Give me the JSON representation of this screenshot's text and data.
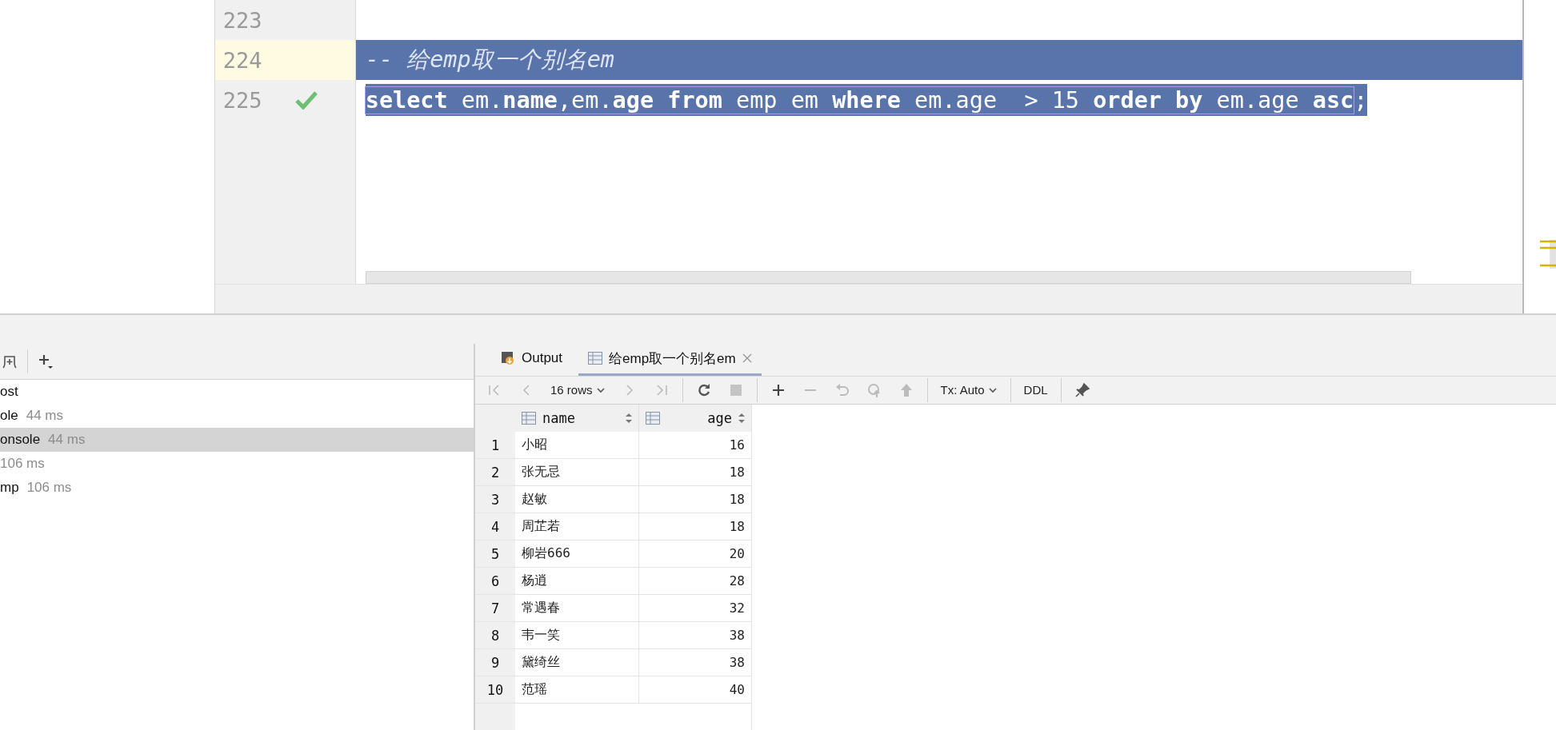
{
  "editor": {
    "lines": [
      {
        "number": "223",
        "current": false,
        "check_mark": false,
        "selected": false
      },
      {
        "number": "224",
        "current": true,
        "check_mark": false,
        "selected": true,
        "tokens": [
          {
            "text": "-- 给emp取一个别名em",
            "kind": "comment"
          }
        ]
      },
      {
        "number": "225",
        "current": false,
        "check_mark": true,
        "selected": true,
        "tokens": [
          {
            "text": "select",
            "kind": "keyword"
          },
          {
            "text": " em.",
            "kind": "plain"
          },
          {
            "text": "name",
            "kind": "keyword"
          },
          {
            "text": ",em.",
            "kind": "plain"
          },
          {
            "text": "age",
            "kind": "keyword"
          },
          {
            "text": " from",
            "kind": "keyword"
          },
          {
            "text": " emp em ",
            "kind": "plain"
          },
          {
            "text": "where",
            "kind": "keyword"
          },
          {
            "text": " em.age  > 15 ",
            "kind": "plain"
          },
          {
            "text": "order by",
            "kind": "keyword"
          },
          {
            "text": " em.age ",
            "kind": "plain"
          },
          {
            "text": "asc",
            "kind": "keyword"
          }
        ],
        "after": ";"
      }
    ]
  },
  "services": [
    {
      "name": "ost",
      "selected": false
    },
    {
      "name": "ole",
      "time": "44 ms",
      "selected": false
    },
    {
      "name": "onsole",
      "time": "44 ms",
      "selected": true
    },
    {
      "time": "106 ms",
      "selected": false
    },
    {
      "name": "mp",
      "time": "106 ms",
      "selected": false
    }
  ],
  "result_tabs": [
    {
      "label": "Output",
      "kind": "output",
      "selected": false
    },
    {
      "label": "给emp取一个别名em",
      "kind": "table",
      "selected": true
    }
  ],
  "result_toolbar": {
    "rows": "16 rows",
    "tx": "Tx: Auto",
    "ddl": "DDL"
  },
  "table": {
    "columns": [
      "name",
      "age"
    ],
    "rows": [
      {
        "index": "1",
        "name": "小昭",
        "age": "16"
      },
      {
        "index": "2",
        "name": "张无忌",
        "age": "18"
      },
      {
        "index": "3",
        "name": "赵敏",
        "age": "18"
      },
      {
        "index": "4",
        "name": "周芷若",
        "age": "18"
      },
      {
        "index": "5",
        "name": "柳岩666",
        "age": "20"
      },
      {
        "index": "6",
        "name": "杨逍",
        "age": "28"
      },
      {
        "index": "7",
        "name": "常遇春",
        "age": "32"
      },
      {
        "index": "8",
        "name": "韦一笑",
        "age": "38"
      },
      {
        "index": "9",
        "name": "黛绮丝",
        "age": "38"
      },
      {
        "index": "10",
        "name": "范瑶",
        "age": "40"
      }
    ]
  }
}
